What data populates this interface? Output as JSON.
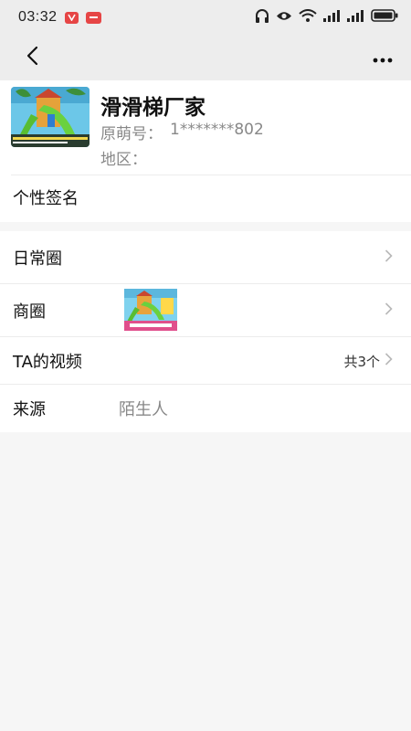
{
  "status_bar": {
    "time": "03:32",
    "icons": [
      "notification-v-icon",
      "notification-app-icon",
      "headphone-icon",
      "eye-icon",
      "wifi-icon",
      "signal-icon",
      "signal-icon",
      "battery-icon"
    ]
  },
  "nav": {
    "back_icon": "back-arrow-icon",
    "more_icon": "more-dots-icon"
  },
  "profile": {
    "name": "滑滑梯厂家",
    "id_label": "原萌号：",
    "id_value": "1*******802",
    "region_label": "地区：",
    "signature_label": "个性签名"
  },
  "menu": {
    "daily_circle": "日常圈",
    "business_circle": "商圈",
    "videos_label": "TA的视频",
    "videos_count": "共3个",
    "source_label": "来源",
    "source_value": "陌生人"
  },
  "colors": {
    "background": "#f6f6f6",
    "bar": "#ededed",
    "card": "#ffffff",
    "muted_text": "#888888",
    "accent_green": "#5fbf3a"
  }
}
